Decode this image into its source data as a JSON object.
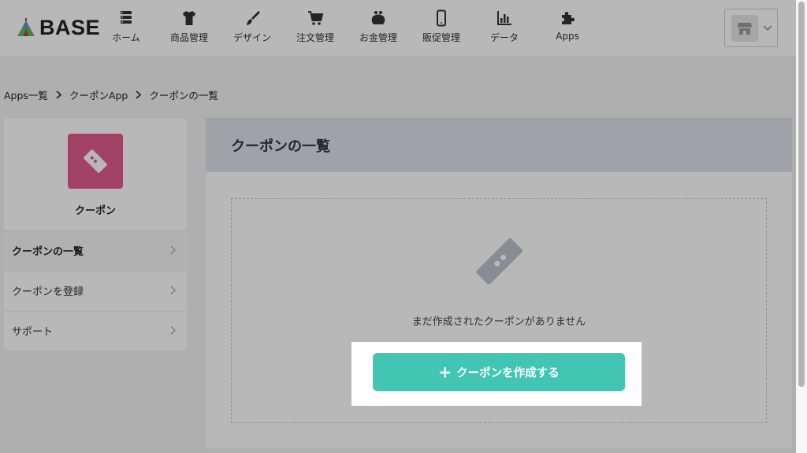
{
  "header": {
    "logo_text": "BASE",
    "nav": [
      {
        "label": "ホーム",
        "icon": "home-list-icon"
      },
      {
        "label": "商品管理",
        "icon": "tshirt-icon"
      },
      {
        "label": "デザイン",
        "icon": "brush-icon"
      },
      {
        "label": "注文管理",
        "icon": "cart-icon"
      },
      {
        "label": "お金管理",
        "icon": "purse-icon"
      },
      {
        "label": "販促管理",
        "icon": "phone-icon"
      },
      {
        "label": "データ",
        "icon": "bar-chart-icon"
      },
      {
        "label": "Apps",
        "icon": "puzzle-icon"
      }
    ]
  },
  "breadcrumb": [
    "Apps一覧",
    "クーポンApp",
    "クーポンの一覧"
  ],
  "sidebar": {
    "app_name": "クーポン",
    "items": [
      {
        "label": "クーポンの一覧",
        "active": true
      },
      {
        "label": "クーポンを登録",
        "active": false
      },
      {
        "label": "サポート",
        "active": false
      }
    ]
  },
  "main": {
    "title": "クーポンの一覧",
    "empty_text": "まだ作成されたクーポンがありません",
    "create_button_label": "クーポンを作成する"
  },
  "colors": {
    "accent": "#42c5b3",
    "app_icon": "#e05a8c",
    "panel_header": "#dde2ea"
  }
}
